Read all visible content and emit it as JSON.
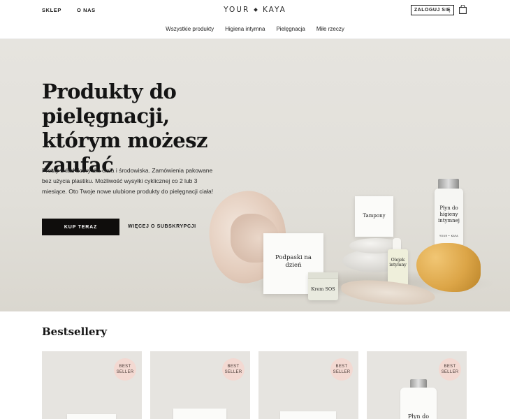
{
  "header": {
    "nav_left": [
      "SKLEP",
      "O NAS"
    ],
    "logo_left": "YOUR",
    "logo_right": "KAYA",
    "login_label": "ZALOGUJ SIĘ",
    "cart_icon": "shopping-bag-icon",
    "categories": [
      "Wszystkie produkty",
      "Higiena intymna",
      "Pielęgnacja",
      "Miłe rzeczy"
    ]
  },
  "hero": {
    "title": "Produkty do pielęgnacji, którym możesz zaufać",
    "text": "Prosty skład dobry dla ciała i środowiska. Zamówienia pakowane bez użycia plastiku. Możliwość wysyłki cyklicznej co 2 lub 3 miesiące. Oto Twoje nowe ulubione produkty do pielęgnacji ciała!",
    "cta_primary": "KUP TERAZ",
    "cta_secondary": "WIĘCEJ O SUBSKRYPCJI",
    "products": {
      "pads": "Podpaski na dzień",
      "tampons": "Tampony",
      "cream": "Krem SOS",
      "oil": "Olejek intymny",
      "wash": "Płyn do higieny intymnej",
      "bottle_brand": "YOUR • KAYA"
    }
  },
  "bestsellers": {
    "title": "Bestsellery",
    "badge_line1": "BEST",
    "badge_line2": "SELLER",
    "card4_label": "Płyn do"
  },
  "colors": {
    "hero_bg": "#e3e1dc",
    "cta_bg": "#0f0d0c",
    "badge_bg": "#f3d9d2",
    "card_bg": "#e6e4e0"
  }
}
